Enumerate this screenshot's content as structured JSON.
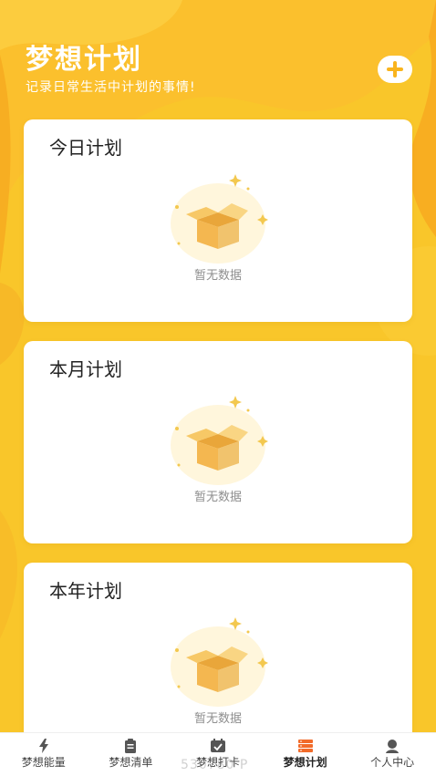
{
  "header": {
    "title": "梦想计划",
    "subtitle": "记录日常生活中计划的事情!",
    "add_icon": "plus-icon"
  },
  "cards": [
    {
      "title": "今日计划",
      "empty_text": "暂无数据",
      "icon": "empty-box-icon"
    },
    {
      "title": "本月计划",
      "empty_text": "暂无数据",
      "icon": "empty-box-icon"
    },
    {
      "title": "本年计划",
      "empty_text": "暂无数据",
      "icon": "empty-box-icon"
    }
  ],
  "tabbar": {
    "items": [
      {
        "label": "梦想能量",
        "icon": "lightning-icon",
        "active": false
      },
      {
        "label": "梦想清单",
        "icon": "clipboard-icon",
        "active": false
      },
      {
        "label": "梦想打卡",
        "icon": "checkin-icon",
        "active": false
      },
      {
        "label": "梦想计划",
        "icon": "plan-list-icon",
        "active": true
      },
      {
        "label": "个人中心",
        "icon": "user-icon",
        "active": false
      }
    ]
  },
  "watermark": "530780 P",
  "colors": {
    "background": "#f9c62a",
    "accent": "#f6891f",
    "active_tab_icon": "#f26b2a",
    "inactive_tab_icon": "#555555",
    "card": "#ffffff"
  }
}
